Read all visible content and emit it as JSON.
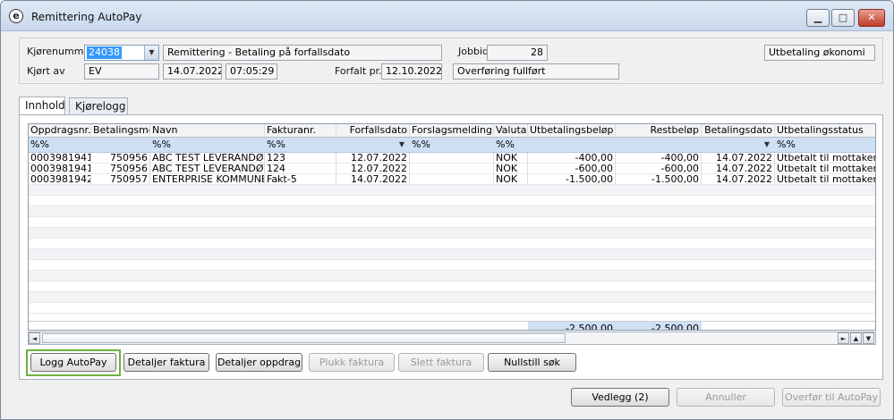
{
  "window": {
    "title": "Remittering AutoPay",
    "app_icon_glyph": "e",
    "minimize_glyph": "▁",
    "maximize_glyph": "□",
    "close_glyph": "✕"
  },
  "header": {
    "kjorenummer_label": "Kjørenummer",
    "kjorenummer_value": "24038",
    "description_value": "Remittering - Betaling på forfallsdato",
    "jobbid_label": "Jobbid.",
    "jobbid_value": "28",
    "category_value": "Utbetaling økonomi",
    "kjort_av_label": "Kjørt av",
    "kjort_av_value": "EV",
    "run_date_value": "14.07.2022",
    "run_time_value": "07:05:29",
    "forfalt_label": "Forfalt pr.",
    "forfalt_value": "12.10.2022",
    "status_value": "Overføring fullført"
  },
  "tabs": [
    {
      "label": "Innhold",
      "active": true
    },
    {
      "label": "Kjørelogg",
      "active": false
    }
  ],
  "grid": {
    "columns": [
      "Oppdragsnr.",
      "Betalingsmott",
      "Navn",
      "Fakturanr.",
      "Forfallsdato",
      "Forslagsmelding",
      "Valuta",
      "Utbetalingsbeløp",
      "Restbeløp",
      "Betalingsdato",
      "Utbetalingsstatus"
    ],
    "filters": [
      "%%",
      "",
      "%%",
      "%%",
      "",
      "%%",
      "%%",
      "",
      "",
      "",
      "%%"
    ],
    "rows": [
      [
        "0003981941",
        "750956",
        "ABC TEST LEVERANDØR",
        "123",
        "12.07.2022",
        "",
        "NOK",
        "-400,00",
        "-400,00",
        "14.07.2022",
        "Utbetalt til mottaker"
      ],
      [
        "0003981941",
        "750956",
        "ABC TEST LEVERANDØR",
        "124",
        "12.07.2022",
        "",
        "NOK",
        "-600,00",
        "-600,00",
        "14.07.2022",
        "Utbetalt til mottaker"
      ],
      [
        "0003981942",
        "750957",
        "ENTERPRISE KOMMUNE",
        "Fakt-5",
        "14.07.2022",
        "",
        "NOK",
        "-1.500,00",
        "-1.500,00",
        "14.07.2022",
        "Utbetalt til mottaker"
      ]
    ],
    "totals": {
      "utbetalingsbelop": "-2.500,00",
      "restbelop": "-2.500,00"
    },
    "filter_dropdown_glyph": "▼"
  },
  "scroll": {
    "left": "◄",
    "right": "►",
    "up": "▲",
    "down": "▼"
  },
  "buttons": {
    "logg_autopay": "Logg AutoPay",
    "detaljer_faktura": "Detaljer faktura",
    "detaljer_oppdrag": "Detaljer oppdrag",
    "plukk_faktura": "Plukk faktura",
    "slett_faktura": "Slett faktura",
    "nullstill_sok": "Nullstill søk",
    "vedlegg": "Vedlegg (2)",
    "annuller": "Annuller",
    "overfor": "Overfør til AutoPay"
  },
  "colors": {
    "focus": "#6fb043",
    "selection": "#3399ff",
    "filter_row": "#cfe0f4"
  }
}
